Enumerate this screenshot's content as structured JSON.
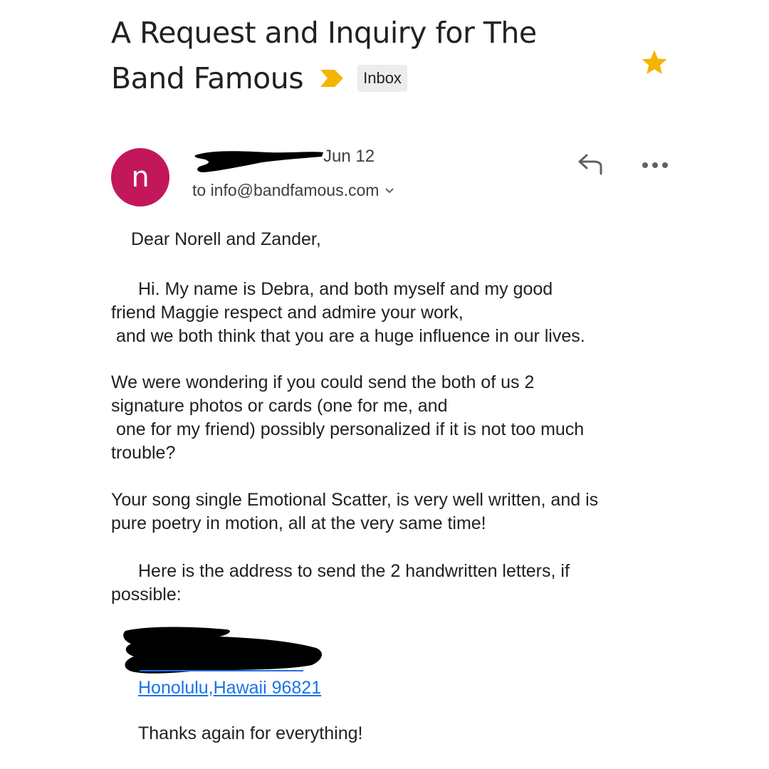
{
  "email": {
    "subject_line1": "A Request and Inquiry for The",
    "subject_line2": "Band Famous",
    "label": "Inbox",
    "sender_initial": "n",
    "date": "Jun 12",
    "recipient": "to info@bandfamous.com",
    "greeting": "Dear Norell and Zander,",
    "para1": [
      "Hi. My name is Debra, and both myself and my good",
      "friend Maggie respect and admire your work,",
      " and we both think that you are a huge influence in our lives."
    ],
    "para2": [
      "We were wondering if you could send the both of us 2",
      "signature photos or cards (one for me, and",
      " one for my friend) possibly personalized if it is not too much",
      "trouble?"
    ],
    "para3": [
      "Your song single Emotional Scatter, is very well written, and is",
      "pure poetry in motion, all at the very same time!"
    ],
    "para4": [
      "Here is the address to send the 2 handwritten letters, if",
      "possible:"
    ],
    "address_link": "Honolulu,Hawaii 96821",
    "closing": "Thanks again for everything!"
  },
  "colors": {
    "avatar": "#c2185b",
    "star": "#f4b400",
    "importance": "#f4b400",
    "link": "#1a73e8"
  },
  "icons": [
    "importance-marker-icon",
    "star-icon",
    "reply-icon",
    "more-options-icon",
    "chevron-down-icon"
  ]
}
